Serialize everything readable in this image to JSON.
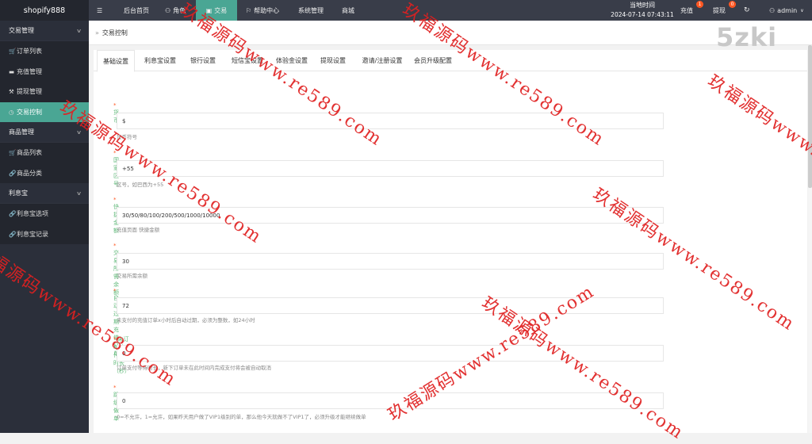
{
  "sidebar": {
    "logo": "shopify888",
    "groups": [
      {
        "label": "交易管理",
        "items": [
          {
            "label": "订单列表",
            "icon": "cart-icon"
          },
          {
            "label": "充值管理",
            "icon": "card-icon"
          },
          {
            "label": "提现管理",
            "icon": "gavel-icon"
          },
          {
            "label": "交易控制",
            "icon": "dashboard-icon",
            "active": true
          }
        ]
      },
      {
        "label": "商品管理",
        "items": [
          {
            "label": "商品列表",
            "icon": "cart-icon"
          },
          {
            "label": "商品分类",
            "icon": "link-icon"
          }
        ]
      },
      {
        "label": "利息宝",
        "items": [
          {
            "label": "利息宝选项",
            "icon": "link-icon"
          },
          {
            "label": "利息宝记录",
            "icon": "link-icon"
          }
        ]
      }
    ]
  },
  "topbar": {
    "menu_icon": "☰",
    "nav": [
      {
        "label": "后台首页",
        "icon": ""
      },
      {
        "label": "角色",
        "icon": "user-icon"
      },
      {
        "label": "交易",
        "icon": "bag-icon",
        "active": true
      },
      {
        "label": "帮助中心",
        "icon": "flag-icon"
      },
      {
        "label": "系统管理",
        "icon": ""
      },
      {
        "label": "商城",
        "icon": ""
      }
    ],
    "time_label": "当地时间",
    "time_value": "2024-07-14 07:43:11",
    "recharge": {
      "label": "充值",
      "badge": "1"
    },
    "withdraw": {
      "label": "提现",
      "badge": "0"
    },
    "user": "admin"
  },
  "breadcrumb": {
    "sep": "»",
    "label": "交易控制"
  },
  "corner_watermark": "5zki",
  "tabs": [
    "基础设置",
    "利息宝设置",
    "银行设置",
    "短信宝设置",
    "体验金设置",
    "提现设置",
    "邀请/注册设置",
    "会员升级配置"
  ],
  "form": [
    {
      "label": "货币",
      "value": "$",
      "help": "货币符号"
    },
    {
      "label": "国家区号",
      "value": "+55",
      "help": "区号，如巴西为+55"
    },
    {
      "label": "快捷金额",
      "value": "30/50/80/100/200/500/1000/10000",
      "help": "充值页面 快捷金额"
    },
    {
      "label": "交易所需余额",
      "value": "30",
      "help": "交易所需余额"
    },
    {
      "label": "自动过期充值订单",
      "value": "72",
      "help": "未支付的充值订单x小时后自动过期，必须为整数，如24小时"
    },
    {
      "label": "未订单的支付等待时长（秒）",
      "value": "0",
      "help": "订单支付等待时长，新下订单未在此时间内完成支付将会被自动取消"
    },
    {
      "label": "跳级做单",
      "value": "0",
      "help": "0=不允许，1=允许，如果昨天用户做了VIP1级别的单，那么他今天就做不了VIP1了，必须升级才能继续做单"
    }
  ],
  "watermarks": [
    "玖福源码www.re589.com",
    "玖福源码www.re589.com",
    "玖福源码www.re589.com",
    "玖福源码www.re589.com",
    "玖福源码www.re589.com",
    "玖福源码www.re589.com",
    "玖福源码www.re589.com",
    "玖福源码www.re589.com"
  ]
}
